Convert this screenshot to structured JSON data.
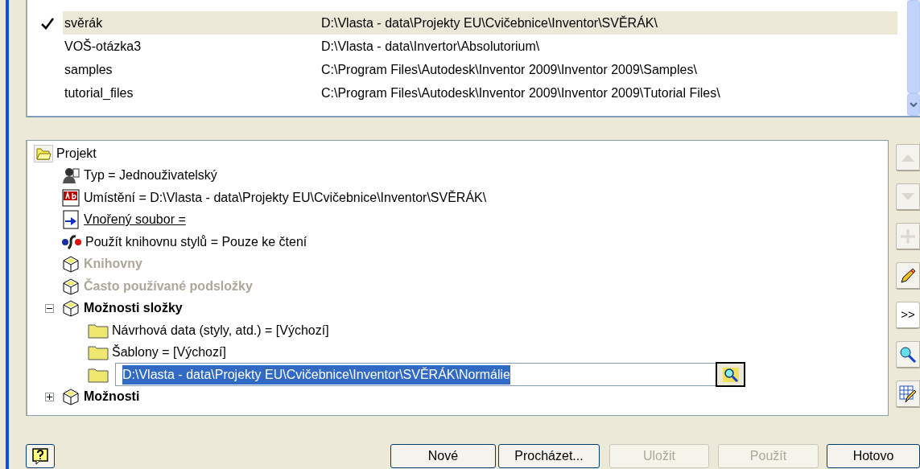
{
  "projects": [
    {
      "name": "svěrák",
      "path": "D:\\Vlasta - data\\Projekty EU\\Cvičebnice\\Inventor\\SVĚRÁK\\",
      "selected": true
    },
    {
      "name": "VOŠ-otázka3",
      "path": "D:\\Vlasta - data\\Invertor\\Absolutorium\\",
      "selected": false
    },
    {
      "name": "samples",
      "path": "C:\\Program Files\\Autodesk\\Inventor 2009\\Inventor 2009\\Samples\\",
      "selected": false
    },
    {
      "name": "tutorial_files",
      "path": "C:\\Program Files\\Autodesk\\Inventor 2009\\Inventor 2009\\Tutorial Files\\",
      "selected": false
    }
  ],
  "tree": [
    {
      "kind": "project",
      "label": "Projekt",
      "children": [
        {
          "kind": "user",
          "label": "Typ = Jednouživatelský"
        },
        {
          "kind": "text",
          "label": "Umístění = D:\\Vlasta - data\\Projekty EU\\Cvičebnice\\Inventor\\SVĚRÁK\\"
        },
        {
          "kind": "link",
          "label": "Vnořený soubor =",
          "underlined": true
        },
        {
          "kind": "style",
          "label": "Použít knihovnu stylů = Pouze ke čtení"
        },
        {
          "kind": "box",
          "label": "Knihovny",
          "bold": true,
          "disabled": true
        },
        {
          "kind": "box",
          "label": "Často používané podsložky",
          "bold": true,
          "disabled": true
        },
        {
          "kind": "box",
          "label": "Možnosti složky",
          "bold": true,
          "disabled": false,
          "expanded": true,
          "children": [
            {
              "kind": "folder",
              "label": "Návrhová data (styly, atd.) = [Výchozí]"
            },
            {
              "kind": "folder",
              "label": "Šablony = [Výchozí]"
            },
            {
              "kind": "folder-edit",
              "value": "D:\\Vlasta - data\\Projekty EU\\Cvičebnice\\Inventor\\SVĚRÁK\\Normálie",
              "selected": true
            }
          ]
        },
        {
          "kind": "box",
          "label": "Možnosti",
          "bold": true,
          "disabled": false,
          "expanded": false
        }
      ]
    }
  ],
  "toolbar": [
    {
      "kind": "up",
      "disabled": true
    },
    {
      "kind": "down",
      "disabled": true
    },
    {
      "kind": "plus",
      "disabled": true
    },
    {
      "kind": "pencil",
      "disabled": false
    },
    {
      "kind": "text",
      "label": ">>",
      "disabled": false
    },
    {
      "kind": "search",
      "disabled": false
    },
    {
      "kind": "grid-pencil",
      "disabled": false
    }
  ],
  "buttons": [
    {
      "label": "Nové",
      "disabled": false
    },
    {
      "label": "Procházet...",
      "disabled": false
    },
    {
      "label": "Uložit",
      "disabled": true
    },
    {
      "label": "Použít",
      "disabled": true
    },
    {
      "label": "Hotovo",
      "disabled": false
    }
  ]
}
